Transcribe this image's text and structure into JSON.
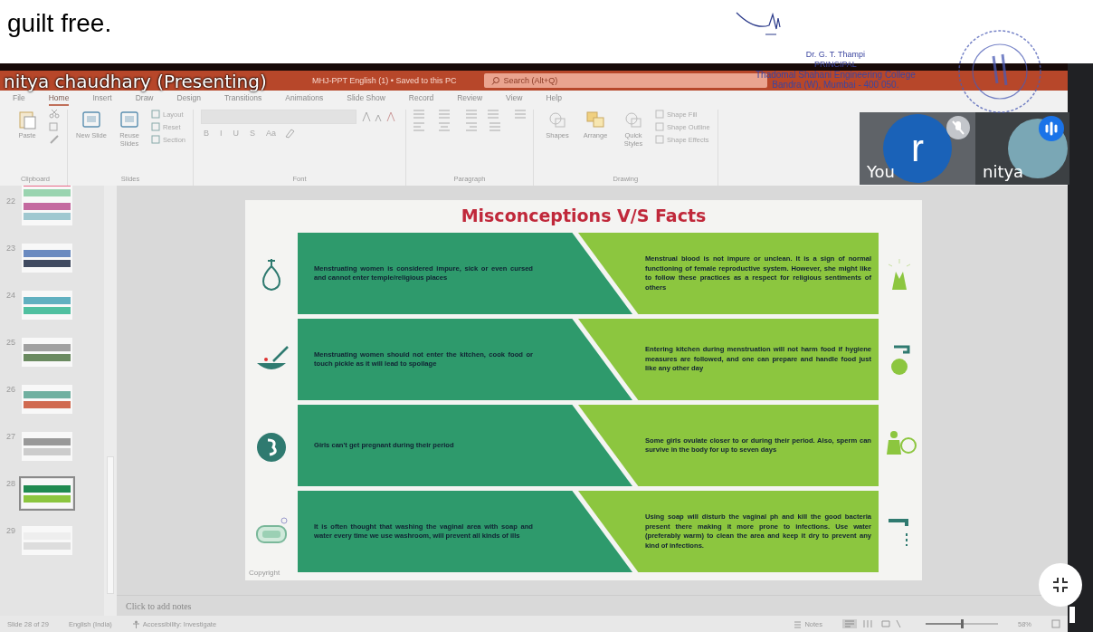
{
  "document": {
    "text": "guilt free.",
    "signatory": [
      "Dr. G. T. Thampi",
      "PRINCIPAL",
      "Thadomal Shahani Engineering College",
      "Bandra (W), Mumbai - 400 050."
    ]
  },
  "presenter_label": "nitya chaudhary (Presenting)",
  "title_bar": {
    "title": "MHJ-PPT English (1) • Saved to this PC",
    "search_placeholder": "Search (Alt+Q)"
  },
  "ribbon": {
    "tabs": [
      {
        "label": "File",
        "selected": false
      },
      {
        "label": "Home",
        "selected": true
      },
      {
        "label": "Insert",
        "selected": false
      },
      {
        "label": "Draw",
        "selected": false
      },
      {
        "label": "Design",
        "selected": false
      },
      {
        "label": "Transitions",
        "selected": false
      },
      {
        "label": "Animations",
        "selected": false
      },
      {
        "label": "Slide Show",
        "selected": false
      },
      {
        "label": "Record",
        "selected": false
      },
      {
        "label": "Review",
        "selected": false
      },
      {
        "label": "View",
        "selected": false
      },
      {
        "label": "Help",
        "selected": false
      }
    ],
    "groups": [
      {
        "label": "Clipboard",
        "kind": "clipboard",
        "buttons": [
          "Paste"
        ]
      },
      {
        "label": "Slides",
        "kind": "slides",
        "buttons": [
          "New Slide",
          "Reuse Slides",
          "Layout",
          "Reset",
          "Section"
        ]
      },
      {
        "label": "Font",
        "kind": "font",
        "buttons": [
          "B",
          "I",
          "U",
          "S",
          "Aa"
        ]
      },
      {
        "label": "Paragraph",
        "kind": "paragraph"
      },
      {
        "label": "Drawing",
        "kind": "drawing",
        "buttons": [
          "Shapes",
          "Arrange",
          "Quick Styles",
          "Shape Fill",
          "Shape Outline",
          "Shape Effects"
        ]
      }
    ]
  },
  "thumbnails": [
    {
      "selected": false
    },
    {
      "number": "22",
      "selected": false
    },
    {
      "number": "23",
      "selected": false
    },
    {
      "number": "24",
      "selected": false
    },
    {
      "number": "25",
      "selected": false
    },
    {
      "number": "26",
      "selected": false
    },
    {
      "number": "27",
      "selected": false
    },
    {
      "number": "28",
      "selected": true
    },
    {
      "number": "29",
      "selected": false
    }
  ],
  "slide": {
    "title": "Misconceptions V/S Facts",
    "copyright": "Copyright",
    "rows": [
      {
        "myth": "Menstruating women is considered impure, sick or even cursed and cannot enter temple/religious places",
        "fact": "Menstrual blood is not impure or unclean. It is a sign of normal functioning of female reproductive system. However, she might like to follow these practices as a respect for religious sentiments of others",
        "kind": "drop"
      },
      {
        "myth": "Menstruating women should not enter the kitchen, cook food or touch pickle as it will lead to spoilage",
        "fact": "Entering kitchen during menstruation will not harm food if hygiene measures are followed, and one can prepare and handle food just like any other day",
        "kind": "kitchen"
      },
      {
        "myth": "Girls can't get pregnant during their period",
        "fact": "Some girls ovulate closer to or during their period. Also, sperm can survive in the body for up to seven days",
        "kind": "pregnancy"
      },
      {
        "myth": "It is often thought that washing the vaginal area with soap and water every time we use washroom, will prevent all kinds of ills",
        "fact": "Using soap will disturb the vaginal ph and kill the good bacteria present there making it more prone to infections. Use water (preferably warm) to clean the area and keep it dry to prevent any kind of infections.",
        "kind": "soap"
      }
    ]
  },
  "notes_placeholder": "Click to add notes",
  "status_bar": {
    "slide": "Slide 28 of 29",
    "language": "English (India)",
    "accessibility": "Accessibility: Investigate",
    "notes": "Notes",
    "zoom": "58%",
    "zoom_level": {
      "level": 0.5
    }
  },
  "participants": [
    {
      "name": "You",
      "kind": "letter",
      "letter": "r",
      "muted": true
    },
    {
      "name": "nitya",
      "kind": "photo",
      "muted": false
    }
  ]
}
